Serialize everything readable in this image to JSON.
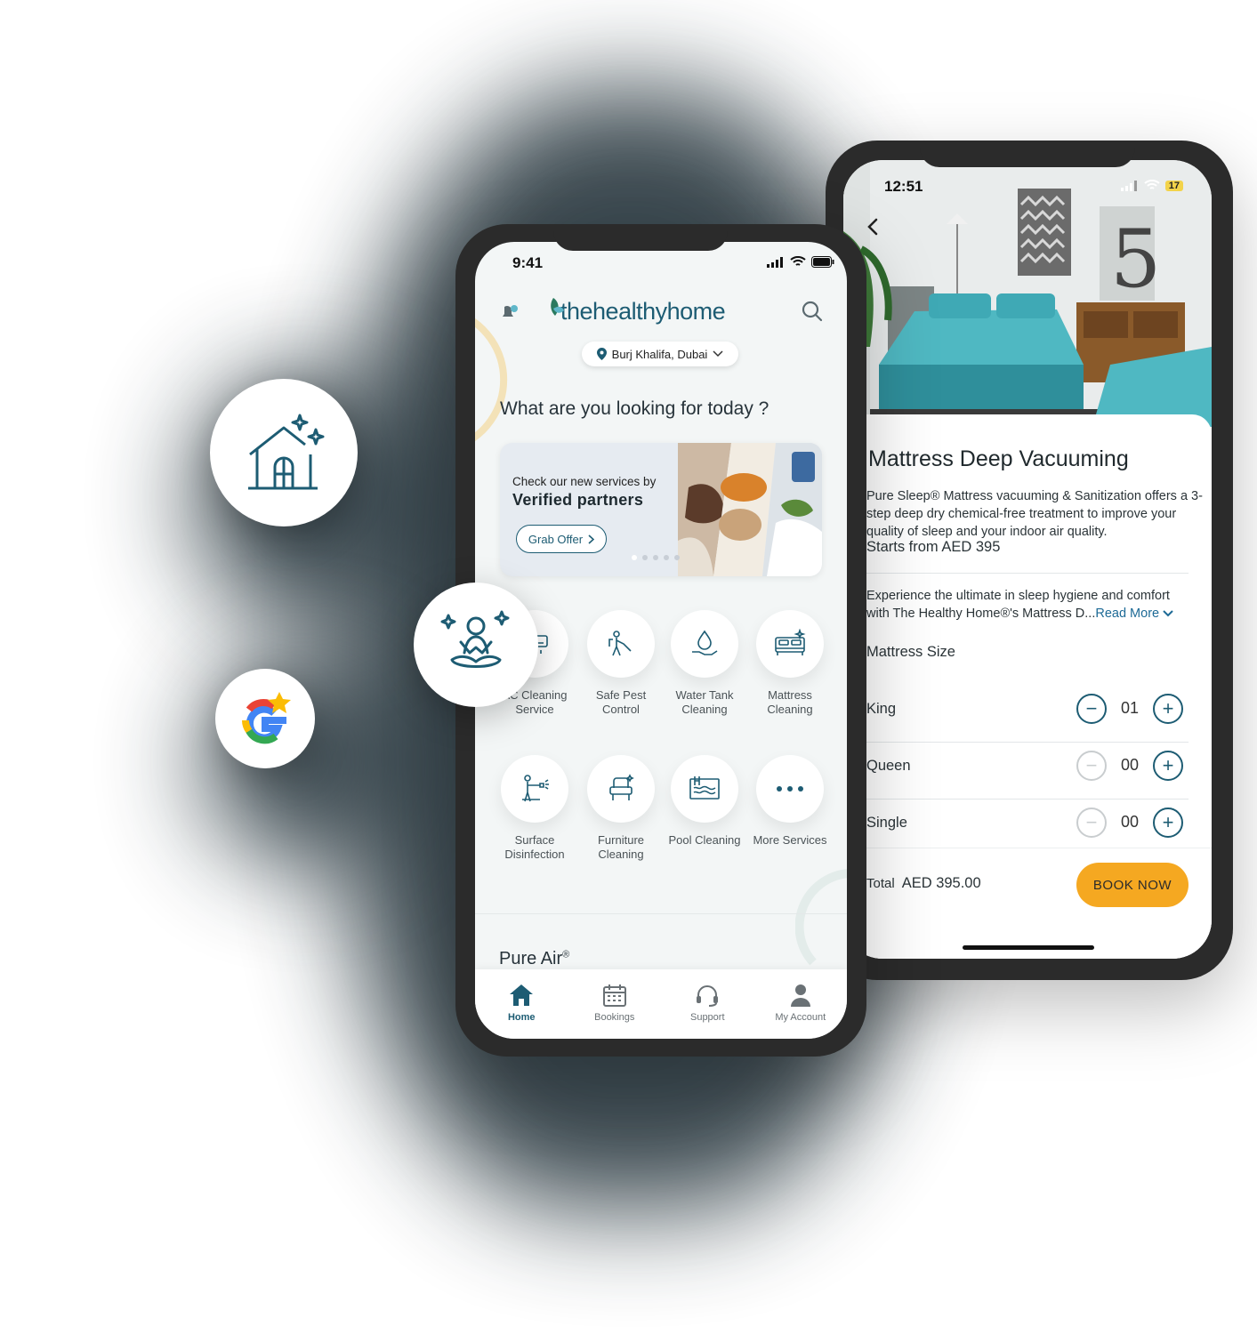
{
  "front_phone": {
    "status": {
      "time": "9:41"
    },
    "header": {
      "brand": "thehealthyhome",
      "location": "Burj Khalifa, Dubai"
    },
    "greeting": "What are you looking for today ?",
    "banner": {
      "line1": "Check our new services by",
      "line2": "Verified partners",
      "button": "Grab Offer"
    },
    "services": [
      {
        "label": "AC Cleaning Service",
        "icon": "ac-icon"
      },
      {
        "label": "Safe Pest Control",
        "icon": "pest-control-icon"
      },
      {
        "label": "Water Tank Cleaning",
        "icon": "water-drop-icon"
      },
      {
        "label": "Mattress Cleaning",
        "icon": "mattress-icon"
      },
      {
        "label": "Surface Disinfection",
        "icon": "spray-icon"
      },
      {
        "label": "Furniture Cleaning",
        "icon": "chair-icon"
      },
      {
        "label": "Pool Cleaning",
        "icon": "pool-icon"
      },
      {
        "label": "More Services",
        "icon": "more-icon"
      }
    ],
    "section_title": "Pure Air",
    "section_mark": "®",
    "tabs": [
      {
        "label": "Home",
        "icon": "home-icon",
        "active": true
      },
      {
        "label": "Bookings",
        "icon": "calendar-icon"
      },
      {
        "label": "Support",
        "icon": "headset-icon"
      },
      {
        "label": "My Account",
        "icon": "user-icon"
      }
    ]
  },
  "back_phone": {
    "status": {
      "time": "12:51",
      "battery": "17"
    },
    "product": {
      "title": "Mattress Deep Vacuuming",
      "description": "Pure Sleep® Mattress vacuuming & Sanitization offers a 3-step deep dry chemical-free treatment to improve your quality of sleep and your indoor air quality.",
      "price": "Starts from AED 395",
      "experience": "Experience the ultimate in sleep hygiene and comfort with The Healthy Home®'s Mattress D...",
      "read_more": "Read More",
      "size_heading": "Mattress Size",
      "sizes": [
        {
          "label": "King",
          "qty": "01"
        },
        {
          "label": "Queen",
          "qty": "00"
        },
        {
          "label": "Single",
          "qty": "00"
        }
      ],
      "total_label": "Total",
      "total_value": "AED 395.00",
      "book_button": "BOOK NOW"
    }
  },
  "colors": {
    "brand": "#1d5c73",
    "accent": "#f5a821",
    "bg": "#f3f6f6"
  }
}
